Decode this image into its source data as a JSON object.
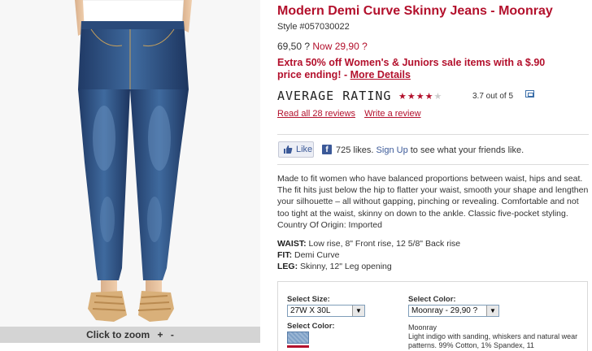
{
  "product": {
    "title": "Modern Demi Curve Skinny Jeans - Moonray",
    "style": "Style #057030022",
    "price_was": "69,50 ?",
    "price_now": "Now 29,90 ?",
    "promo_text": "Extra 50% off Women's & Juniors sale items with a $.90 price ending! - ",
    "promo_link": "More Details"
  },
  "image": {
    "zoom_label": "Click to zoom",
    "zoom_in": "+",
    "zoom_out": "-"
  },
  "rating": {
    "label": "AVERAGE RATING",
    "stars_on": "★★★★",
    "stars_off": "★",
    "text": "3.7 out of 5",
    "read_reviews": "Read all 28 reviews",
    "write_review": "Write a review"
  },
  "social": {
    "like_label": "Like",
    "fb_letter": "f",
    "likes_count": "725 likes.",
    "signup_link": "Sign Up",
    "signup_suffix": " to see what your friends like."
  },
  "description": "Made to fit women who have balanced proportions between waist, hips and seat. The fit hits just below the hip to flatter your waist, smooth your shape and lengthen your silhouette – all without gapping, pinching or revealing. Comfortable and not too tight at the waist, skinny on down to the ankle. Classic five-pocket styling. Country Of Origin: Imported",
  "specs": {
    "waist_label": "WAIST:",
    "waist_value": " Low rise, 8\" Front rise, 12 5/8\" Back rise",
    "fit_label": "FIT:",
    "fit_value": " Demi Curve",
    "leg_label": "LEG:",
    "leg_value": " Skinny, 12\" Leg opening"
  },
  "selectors": {
    "size_label": "Select Size:",
    "size_value": "27W X 30L",
    "color_label": "Select Color:",
    "color_value": "Moonray - 29,90 ?",
    "swatch_label": "Select Color:",
    "color_name": "Moonray",
    "color_desc": "Light indigo with sanding, whiskers and natural wear patterns. 99% Cotton, 1% Spandex, 11"
  },
  "colors": {
    "accent": "#b3102c",
    "facebook": "#3b5998"
  }
}
